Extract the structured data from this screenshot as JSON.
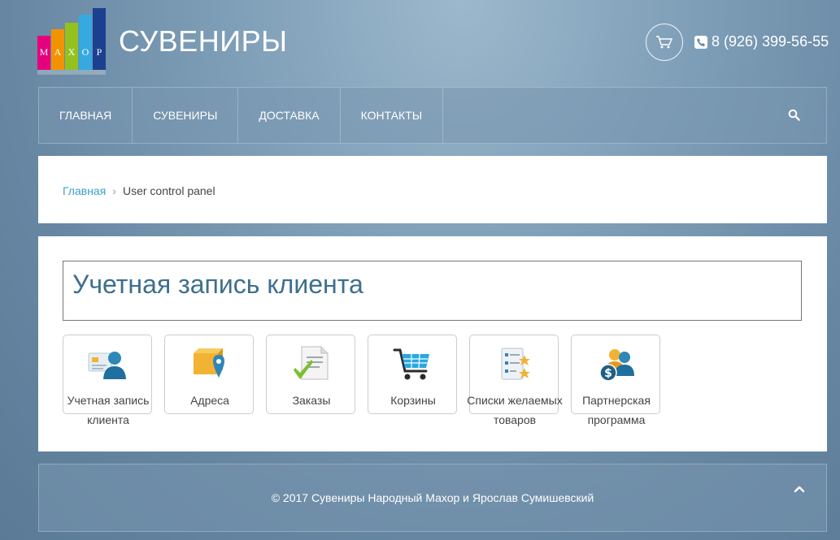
{
  "header": {
    "logo_letters": [
      "M",
      "A",
      "X",
      "O",
      "P"
    ],
    "logo_colors": [
      "#e6007e",
      "#f39200",
      "#95c11f",
      "#36a9e1",
      "#1d3f8f"
    ],
    "site_title": "СУВЕНИРЫ",
    "phone": "8 (926) 399-56-55",
    "cart_icon": "cart-icon",
    "phone_icon": "phone-icon"
  },
  "nav": {
    "items": [
      {
        "label": "ГЛАВНАЯ"
      },
      {
        "label": "СУВЕНИРЫ"
      },
      {
        "label": "ДОСТАВКА"
      },
      {
        "label": "КОНТАКТЫ"
      }
    ],
    "search_icon": "search-icon"
  },
  "breadcrumb": {
    "home": "Главная",
    "separator": "›",
    "current": "User control panel"
  },
  "main": {
    "heading": "Учетная запись клиента",
    "tiles": [
      {
        "label": "Учетная запись клиента",
        "icon": "user-card-icon"
      },
      {
        "label": "Адреса",
        "icon": "address-box-icon"
      },
      {
        "label": "Заказы",
        "icon": "document-check-icon"
      },
      {
        "label": "Корзины",
        "icon": "shopping-cart-icon"
      },
      {
        "label": "Списки желаемых товаров",
        "icon": "wishlist-stars-icon"
      },
      {
        "label": "Партнерская программа",
        "icon": "partner-dollar-icon"
      }
    ]
  },
  "footer": {
    "copyright": "© 2017 Сувениры Народный Махор и Ярослав Сумишевский",
    "to_top_icon": "chevron-up-icon"
  },
  "colors": {
    "accent_link": "#3aa0c8",
    "heading": "#3d6f8f",
    "cart_blue": "#29a8df"
  }
}
